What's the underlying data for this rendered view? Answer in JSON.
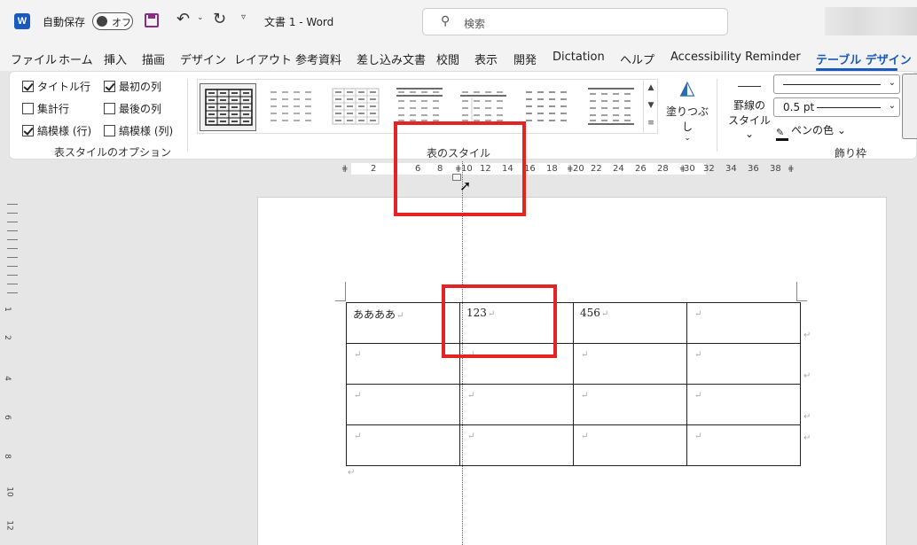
{
  "titlebar": {
    "app_icon_letter": "W",
    "autosave_label": "自動保存",
    "autosave_state": "オフ",
    "doc_title": "文書 1  -  Word",
    "search_placeholder": "検索"
  },
  "tabs": [
    "ファイル",
    "ホーム",
    "挿入",
    "描画",
    "デザイン",
    "レイアウト",
    "参考資料",
    "差し込み文書",
    "校閲",
    "表示",
    "開発",
    "Dictation",
    "ヘルプ",
    "Accessibility Reminder",
    "テーブル デザイン"
  ],
  "active_tab": "テーブル デザイン",
  "style_options": {
    "items": [
      {
        "label": "タイトル行",
        "checked": true
      },
      {
        "label": "集計行",
        "checked": false
      },
      {
        "label": "縞模様 (行)",
        "checked": true
      },
      {
        "label": "最初の列",
        "checked": true
      },
      {
        "label": "最後の列",
        "checked": false
      },
      {
        "label": "縞模様 (列)",
        "checked": false
      }
    ],
    "group_label": "表スタイルのオプション"
  },
  "table_styles": {
    "group_label": "表のスタイル",
    "shading_label": "塗りつぶし"
  },
  "borders": {
    "border_styles_label_1": "罫線の",
    "border_styles_label_2": "スタイル",
    "weight": "0.5 pt",
    "pen_color": "ペンの色",
    "group_label": "飾り枠"
  },
  "ruler": {
    "ticks": [
      "2",
      "6",
      "8",
      "10",
      "12",
      "14",
      "16",
      "18",
      "20",
      "22",
      "24",
      "26",
      "28",
      "30",
      "32",
      "34",
      "36",
      "38"
    ],
    "vticks": [
      "1",
      "2",
      "4",
      "6",
      "8",
      "10",
      "12"
    ]
  },
  "table": {
    "rows": [
      [
        "ああああ",
        "123",
        "456",
        ""
      ],
      [
        "",
        "",
        "",
        ""
      ],
      [
        "",
        "",
        "",
        ""
      ],
      [
        "",
        "",
        "",
        ""
      ]
    ]
  },
  "glyphs": {
    "return_mark": "↵"
  },
  "colors": {
    "accent": "#185abd",
    "highlight": "#e42424"
  }
}
